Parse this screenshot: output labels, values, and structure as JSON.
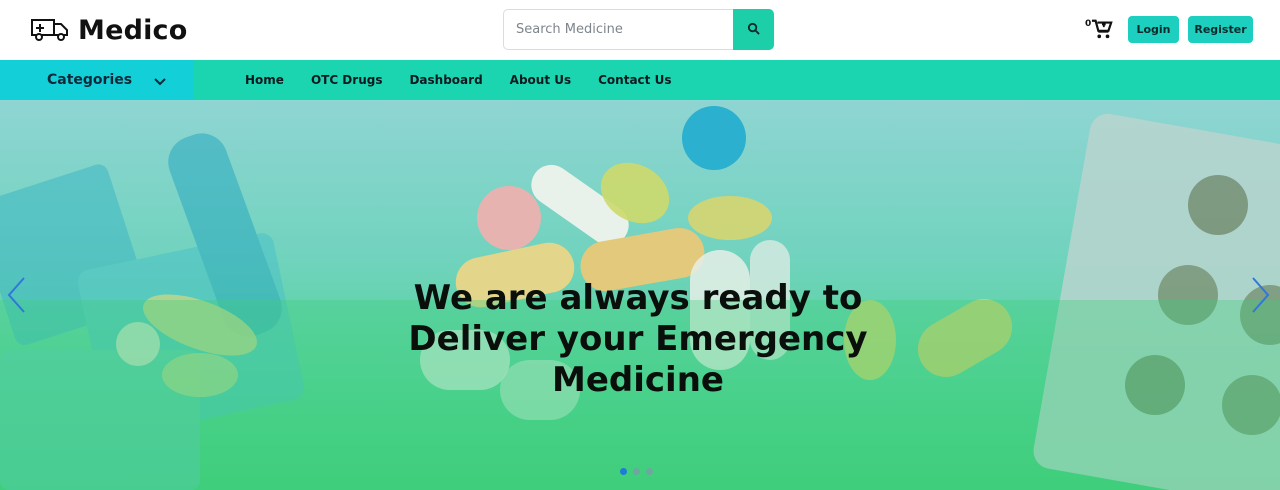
{
  "header": {
    "brand_name": "Medico",
    "search": {
      "placeholder": "Search Medicine"
    },
    "cart_count": "0",
    "login_label": "Login",
    "register_label": "Register"
  },
  "nav": {
    "categories_label": "Categories",
    "links": [
      "Home",
      "OTC Drugs",
      "Dashboard",
      "About Us",
      "Contact Us"
    ]
  },
  "hero": {
    "title_lines": [
      "We are always ready to",
      "Deliver your Emergency",
      "Medicine"
    ],
    "slides_total": 3,
    "active_slide": 1
  },
  "colors": {
    "accent": "#1dcfa9",
    "nav_bg": "#1bd4b0",
    "categories_bg": "#12cfd8",
    "active_dot": "#1f7bd6"
  },
  "icons": {
    "logo": "ambulance-icon",
    "search": "search-icon",
    "cart": "cart-icon",
    "categories": "chevron-down-icon",
    "prev": "chevron-left-icon",
    "next": "chevron-right-icon"
  }
}
